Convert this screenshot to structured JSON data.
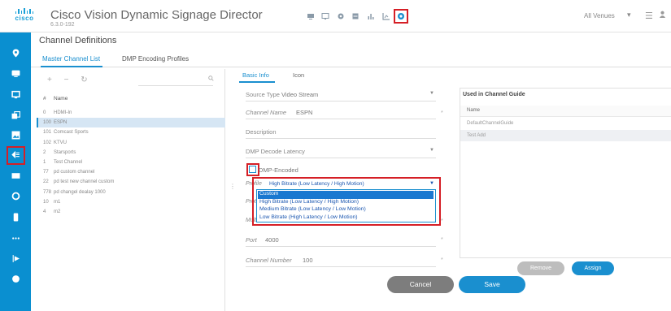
{
  "header": {
    "logo_text": "cisco",
    "title": "Cisco Vision Dynamic Signage Director",
    "version": "6.3.0-192",
    "venue": "All Venues"
  },
  "nav": {
    "items": [
      "location-icon",
      "screen-icon",
      "monitor-icon",
      "layers-icon",
      "image-icon",
      "channels-icon",
      "grid-icon",
      "circle-icon",
      "device-icon",
      "more-icon",
      "dmp-icon",
      "settings-circle-icon"
    ],
    "active": "channels-icon"
  },
  "page": {
    "title": "Channel Definitions",
    "tabs": [
      {
        "label": "Master Channel List",
        "active": true
      },
      {
        "label": "DMP Encoding Profiles",
        "active": false
      }
    ]
  },
  "channel_list": {
    "tools": "+ − ↻",
    "columns": [
      "#",
      "Name"
    ],
    "rows": [
      {
        "num": "0",
        "name": "HDMI-In"
      },
      {
        "num": "100",
        "name": "ESPN",
        "selected": true
      },
      {
        "num": "101",
        "name": "Comcast Sports"
      },
      {
        "num": "102",
        "name": "KTVU"
      },
      {
        "num": "2",
        "name": "Starsports"
      },
      {
        "num": "1",
        "name": "Test Channel"
      },
      {
        "num": "77",
        "name": "pd custom channel"
      },
      {
        "num": "22",
        "name": "pd test new channel custom"
      },
      {
        "num": "778",
        "name": "pd changel dealay 1000"
      },
      {
        "num": "10",
        "name": "m1"
      },
      {
        "num": "4",
        "name": "m2"
      }
    ]
  },
  "form": {
    "subtabs": [
      {
        "label": "Basic Info",
        "active": true
      },
      {
        "label": "Icon",
        "active": false
      }
    ],
    "source_type_label": "Source Type",
    "source_type_value": "Video Stream",
    "channel_name_label": "Channel Name",
    "channel_name_value": "ESPN",
    "description_label": "Description",
    "decode_latency_label": "DMP Decode Latency",
    "dmp_encoded_label": "DMP-Encoded",
    "profile_label": "Profile",
    "profile_value": "High Bitrate (Low Latency / High Motion)",
    "protocol_label": "Protoc",
    "multicast_label": "Multic",
    "port_label": "Port",
    "port_value": "4000",
    "channel_number_label": "Channel Number",
    "channel_number_value": "100",
    "profile_options": [
      "Custom",
      "High Bitrate (Low Latency / High Motion)",
      "Medium Bitrate (Low Latency / Low Motion)",
      "Low Bitrate (High Latency / Low Motion)"
    ],
    "profile_highlighted": "Custom"
  },
  "guide": {
    "title": "Used in Channel Guide",
    "column": "Name",
    "rows": [
      "DefaultChannelGuide",
      "Test Add"
    ]
  },
  "buttons": {
    "remove": "Remove",
    "assign": "Assign",
    "cancel": "Cancel",
    "save": "Save"
  },
  "colors": {
    "nav_bg": "#0a8fd0",
    "accent": "#1a8fcf",
    "highlight_box": "#d51f26"
  }
}
